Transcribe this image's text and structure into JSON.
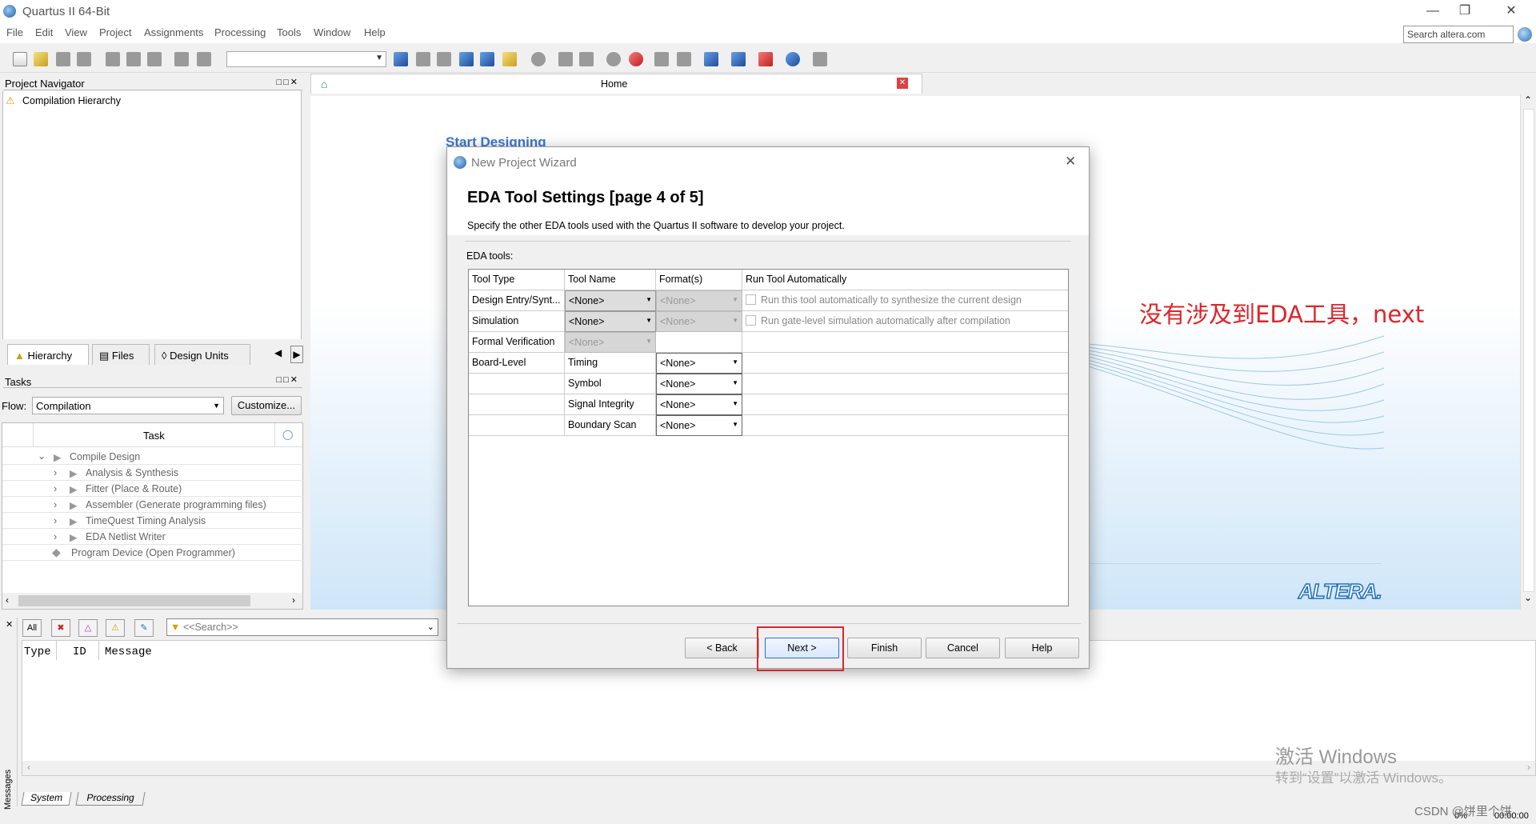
{
  "window": {
    "title": "Quartus II 64-Bit",
    "search_placeholder": "Search altera.com"
  },
  "menu": [
    "File",
    "Edit",
    "View",
    "Project",
    "Assignments",
    "Processing",
    "Tools",
    "Window",
    "Help"
  ],
  "navigator": {
    "title": "Project Navigator",
    "item": "Compilation Hierarchy",
    "tabs": [
      "Hierarchy",
      "Files",
      "Design Units"
    ]
  },
  "tasks": {
    "title": "Tasks",
    "flow_label": "Flow:",
    "flow_value": "Compilation",
    "customize": "Customize...",
    "column": "Task",
    "rows": [
      "Compile Design",
      "Analysis & Synthesis",
      "Fitter (Place & Route)",
      "Assembler (Generate programming files)",
      "TimeQuest Timing Analysis",
      "EDA Netlist Writer",
      "Program Device (Open Programmer)"
    ]
  },
  "home": {
    "tab": "Home",
    "heading": "Start Designing",
    "logo": "ALTERA."
  },
  "messages": {
    "filter_all": "All",
    "search_placeholder": "<<Search>>",
    "cols": [
      "Type",
      "ID",
      "Message"
    ],
    "tabs": [
      "System",
      "Processing"
    ],
    "side_label": "Messages",
    "progress": "0%",
    "time": "00:00:00"
  },
  "dialog": {
    "title": "New Project Wizard",
    "heading": "EDA Tool Settings [page 4 of 5]",
    "subtitle": "Specify the other EDA tools used with the Quartus II software to develop your project.",
    "section": "EDA tools:",
    "headers": [
      "Tool Type",
      "Tool Name",
      "Format(s)",
      "Run Tool Automatically"
    ],
    "rows": [
      {
        "type": "Design Entry/Synt...",
        "name": "<None>",
        "format": "<None>",
        "auto": "Run this tool automatically to synthesize the current design"
      },
      {
        "type": "Simulation",
        "name": "<None>",
        "format": "<None>",
        "auto": "Run gate-level simulation automatically after compilation"
      },
      {
        "type": "Formal Verification",
        "name": "<None>",
        "format": "",
        "auto": ""
      },
      {
        "type": "Board-Level",
        "name": "Timing",
        "format": "<None>",
        "auto": ""
      },
      {
        "type": "",
        "name": "Symbol",
        "format": "<None>",
        "auto": ""
      },
      {
        "type": "",
        "name": "Signal Integrity",
        "format": "<None>",
        "auto": ""
      },
      {
        "type": "",
        "name": "Boundary Scan",
        "format": "<None>",
        "auto": ""
      }
    ],
    "buttons": {
      "back": "< Back",
      "next": "Next >",
      "finish": "Finish",
      "cancel": "Cancel",
      "help": "Help"
    }
  },
  "annotation": "没有涉及到EDA工具，next",
  "watermark": {
    "line1": "激活 Windows",
    "line2": "转到“设置”以激活 Windows。"
  },
  "csdn": "CSDN @饼里个饼"
}
